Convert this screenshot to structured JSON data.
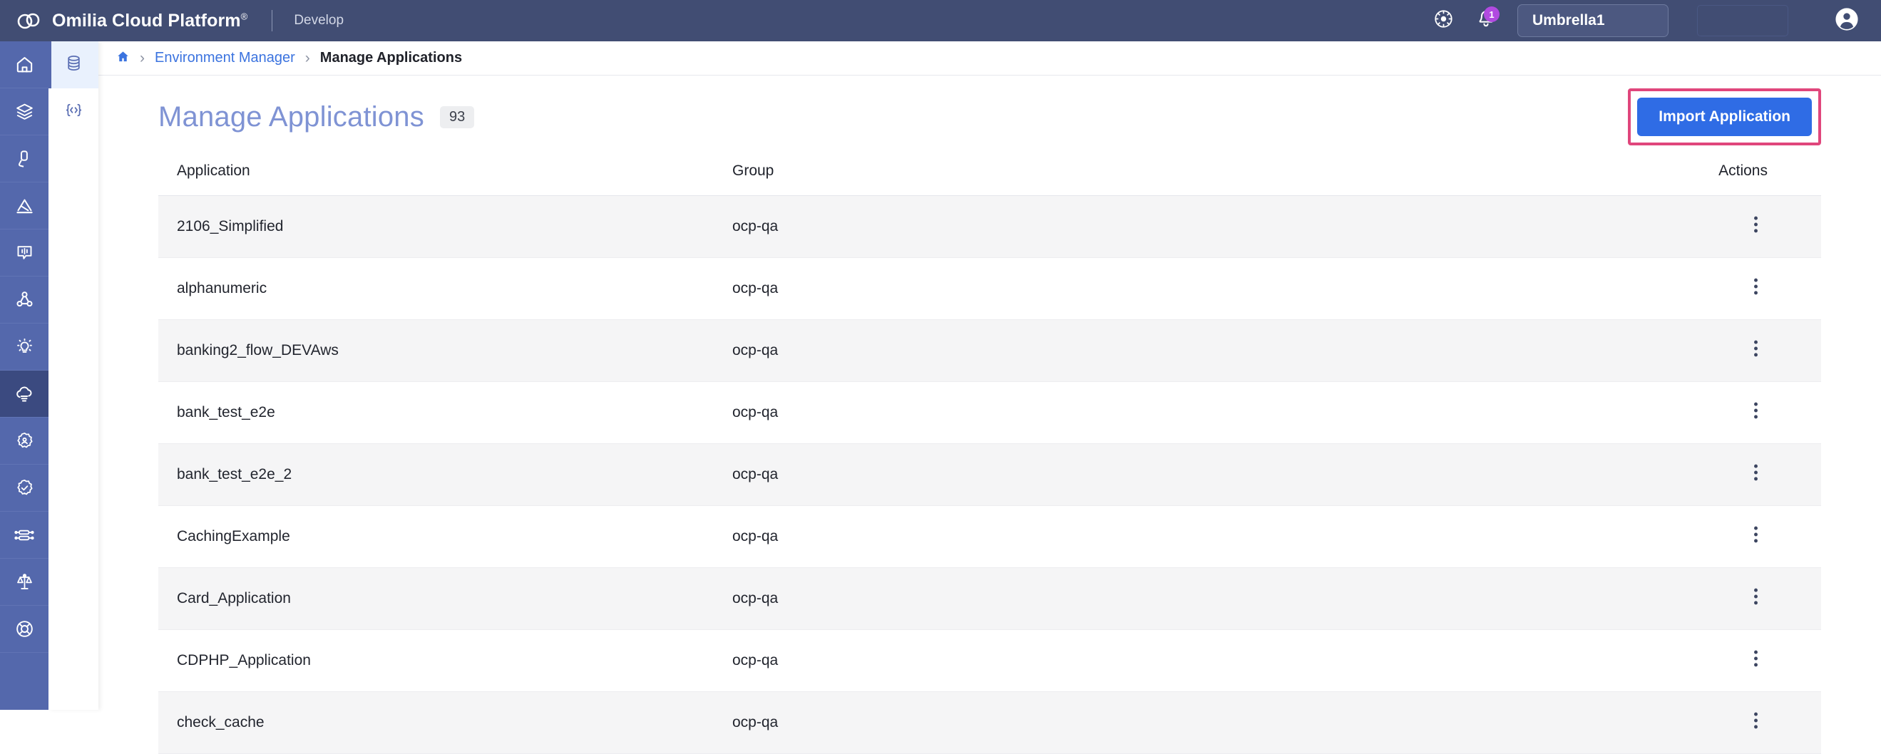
{
  "header": {
    "brand": "Omilia Cloud Platform",
    "brand_sup": "®",
    "environment": "Develop",
    "theme_icon": "sun-icon",
    "bell_icon": "bell-icon",
    "notification_count": "1",
    "tenant": "Umbrella1",
    "avatar_icon": "user-avatar-icon",
    "bg_color": "#414d73"
  },
  "sidebar_primary": {
    "items": [
      {
        "icon": "home-icon",
        "active": false
      },
      {
        "icon": "layers-icon",
        "active": false
      },
      {
        "icon": "phone-handset-icon",
        "active": false
      },
      {
        "icon": "analytics-icon",
        "active": false
      },
      {
        "icon": "voice-bubble-icon",
        "active": false
      },
      {
        "icon": "nodes-network-icon",
        "active": false
      },
      {
        "icon": "lightbulb-icon",
        "active": false
      },
      {
        "icon": "cloud-icon",
        "active": true
      },
      {
        "icon": "gear-badge-icon",
        "active": false
      },
      {
        "icon": "check-badge-icon",
        "active": false
      },
      {
        "icon": "api-server-icon",
        "active": false
      },
      {
        "icon": "scales-icon",
        "active": false
      },
      {
        "icon": "lifebuoy-icon",
        "active": false
      }
    ]
  },
  "sidebar_secondary": {
    "items": [
      {
        "icon": "database-icon",
        "active": true
      },
      {
        "icon": "code-icon",
        "active": false
      }
    ],
    "active_bg": "#e9f1fd",
    "accent": "#5468ac"
  },
  "breadcrumb": {
    "home_icon": "home-icon",
    "separator": "›",
    "link": "Environment Manager",
    "current": "Manage Applications"
  },
  "page": {
    "title": "Manage Applications",
    "count": "93",
    "import_button": "Import Application",
    "button_color": "#2f6ce5",
    "highlight_color": "#e0467c"
  },
  "table": {
    "columns": [
      "Application",
      "Group",
      "Actions"
    ],
    "kebab_icon": "kebab-menu-icon",
    "rows": [
      {
        "application": "2106_Simplified",
        "group": "ocp-qa"
      },
      {
        "application": "alphanumeric",
        "group": "ocp-qa"
      },
      {
        "application": "banking2_flow_DEVAws",
        "group": "ocp-qa"
      },
      {
        "application": "bank_test_e2e",
        "group": "ocp-qa"
      },
      {
        "application": "bank_test_e2e_2",
        "group": "ocp-qa"
      },
      {
        "application": "CachingExample",
        "group": "ocp-qa"
      },
      {
        "application": "Card_Application",
        "group": "ocp-qa"
      },
      {
        "application": "CDPHP_Application",
        "group": "ocp-qa"
      },
      {
        "application": "check_cache",
        "group": "ocp-qa"
      }
    ]
  }
}
